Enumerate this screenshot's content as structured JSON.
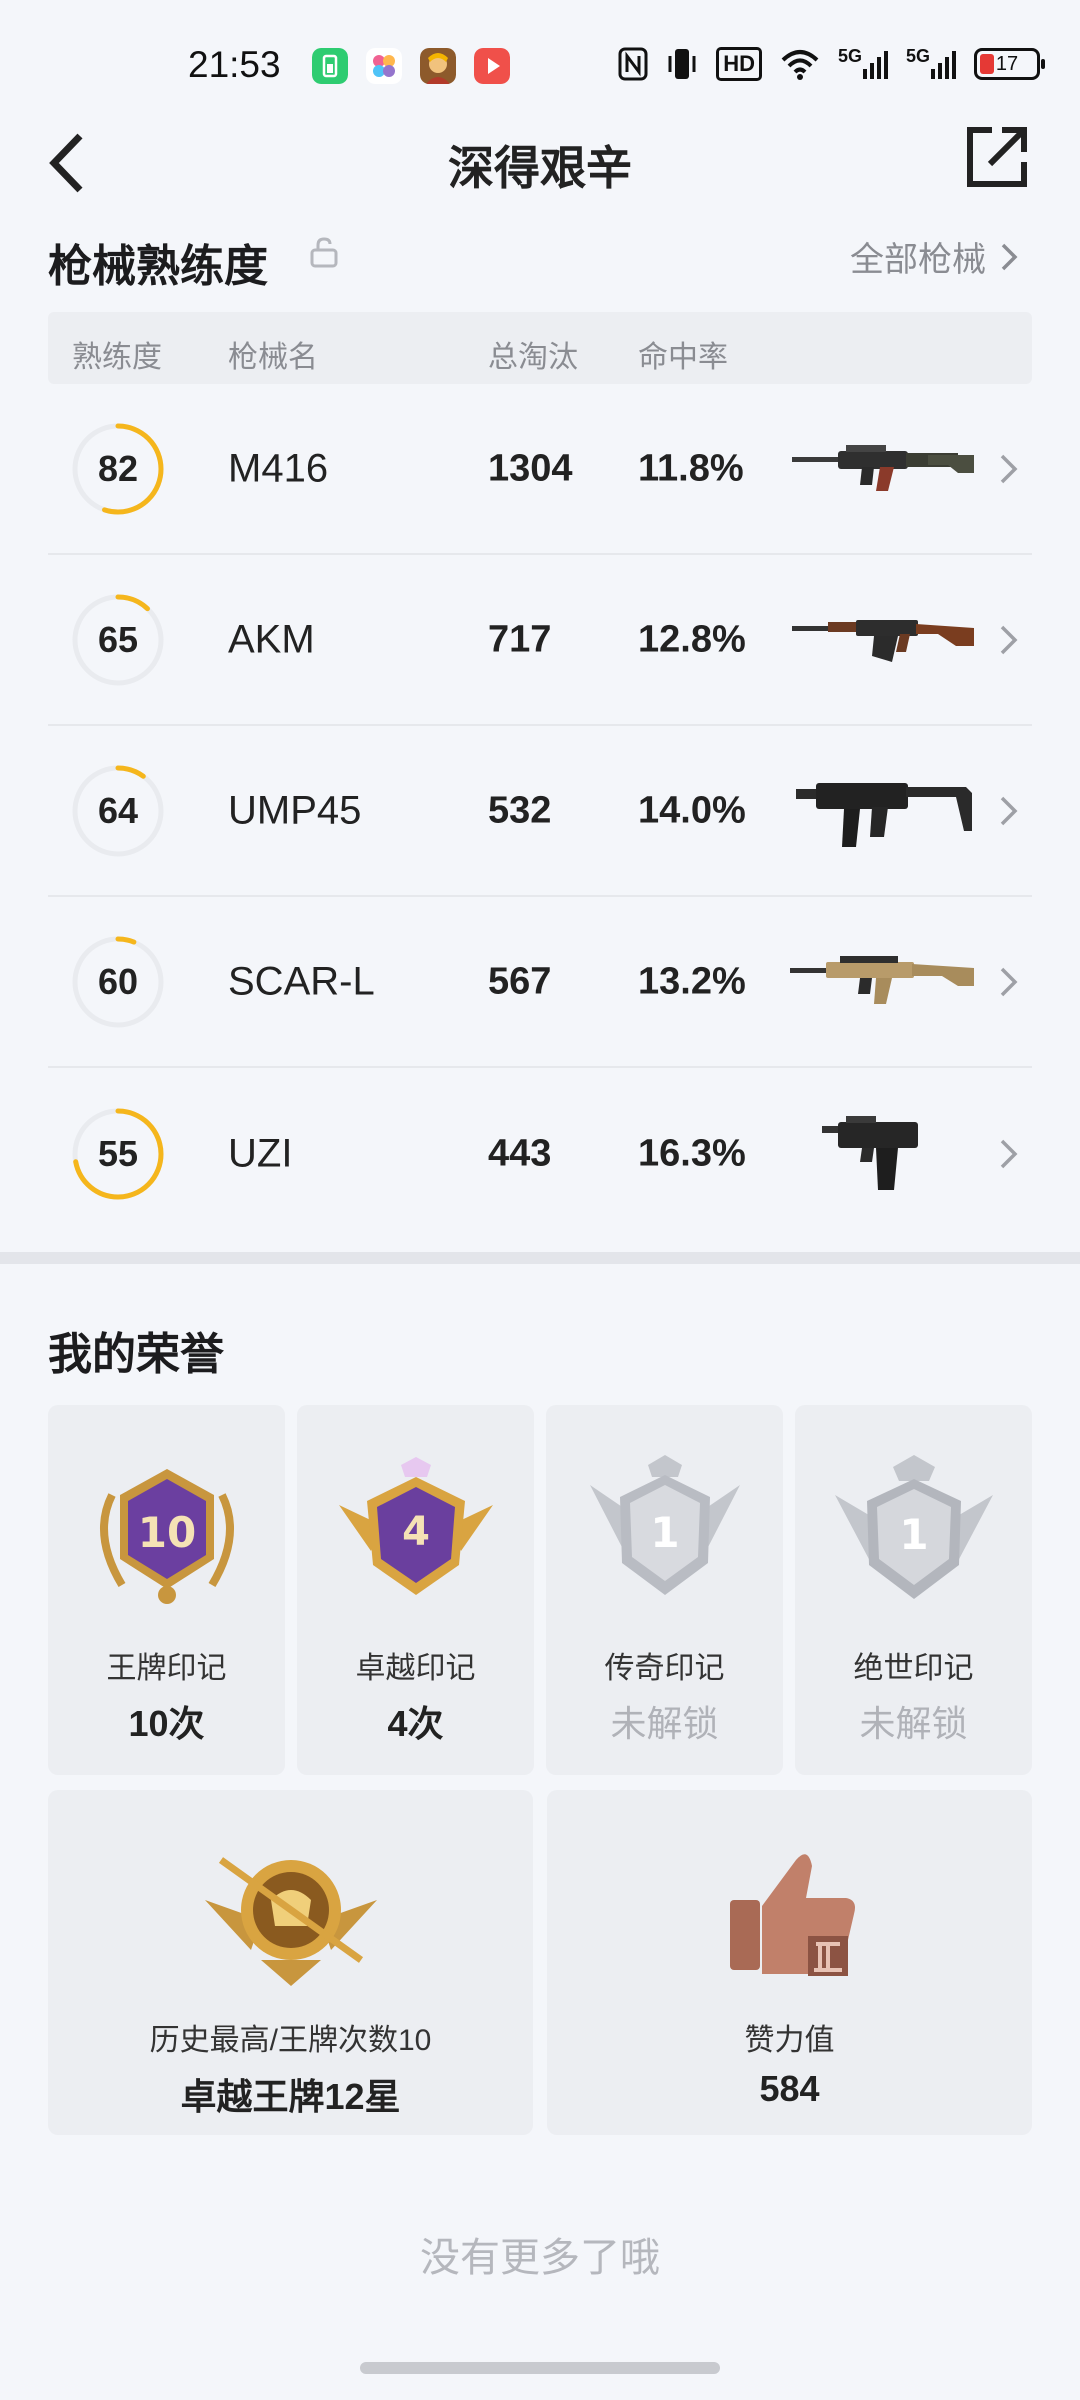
{
  "status_bar": {
    "time": "21:53",
    "hd_badge": "HD",
    "net1": "5G",
    "net2": "5G",
    "battery": "17",
    "icons": [
      "charging-app-icon",
      "flower-app-icon",
      "game-app-icon",
      "video-app-icon",
      "nfc-icon",
      "vibrate-icon",
      "wifi-icon",
      "signal-icon",
      "signal-icon",
      "battery-icon"
    ]
  },
  "header": {
    "title": "深得艰辛"
  },
  "weapons": {
    "section_title": "枪械熟练度",
    "all_link": "全部枪械",
    "columns": [
      "熟练度",
      "枪械名",
      "总淘汰",
      "命中率"
    ],
    "rows": [
      {
        "mastery": "82",
        "progress": 0.55,
        "name": "M416",
        "kills": "1304",
        "hit_rate": "11.8%"
      },
      {
        "mastery": "65",
        "progress": 0.12,
        "name": "AKM",
        "kills": "717",
        "hit_rate": "12.8%"
      },
      {
        "mastery": "64",
        "progress": 0.1,
        "name": "UMP45",
        "kills": "532",
        "hit_rate": "14.0%"
      },
      {
        "mastery": "60",
        "progress": 0.06,
        "name": "SCAR-L",
        "kills": "567",
        "hit_rate": "13.2%"
      },
      {
        "mastery": "55",
        "progress": 0.72,
        "name": "UZI",
        "kills": "443",
        "hit_rate": "16.3%"
      }
    ]
  },
  "honors": {
    "section_title": "我的荣誉",
    "cards": [
      {
        "label": "王牌印记",
        "value": "10次",
        "badge_num": "10",
        "locked": false
      },
      {
        "label": "卓越印记",
        "value": "4次",
        "badge_num": "4",
        "locked": false
      },
      {
        "label": "传奇印记",
        "value": "未解锁",
        "badge_num": "1",
        "locked": true
      },
      {
        "label": "绝世印记",
        "value": "未解锁",
        "badge_num": "1",
        "locked": true
      }
    ],
    "highest": {
      "label": "历史最高/王牌次数10",
      "value": "卓越王牌12星"
    },
    "likes": {
      "label": "赞力值",
      "value": "584"
    }
  },
  "footer": {
    "no_more": "没有更多了哦"
  },
  "colors": {
    "accent": "#f5b61c",
    "ring_track": "#e9ebef",
    "purple_badge": "#6b3fa0",
    "gold": "#d9a441",
    "silver": "#b9bcc3",
    "bronze": "#b57561"
  }
}
